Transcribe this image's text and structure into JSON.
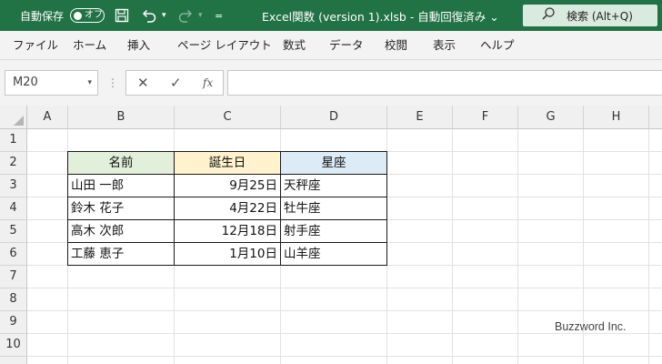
{
  "titlebar": {
    "autosave_label": "自動保存",
    "autosave_state": "オフ",
    "document_title": "Excel関数 (version 1).xlsb  -  自動回復済み  ⌄",
    "search_text": "検索 (Alt+Q)",
    "qat_more": "="
  },
  "menu": {
    "items": [
      "ファイル",
      "ホーム",
      "挿入",
      "ページ レイアウト",
      "数式",
      "データ",
      "校閲",
      "表示",
      "ヘルプ"
    ]
  },
  "formula_bar": {
    "name_box": "M20",
    "cancel_symbol": "✕",
    "enter_symbol": "✓",
    "fx_symbol": "fx",
    "content": ""
  },
  "sheet": {
    "columns": [
      "A",
      "B",
      "C",
      "D",
      "E",
      "F",
      "G",
      "H"
    ],
    "rows": [
      "1",
      "2",
      "3",
      "4",
      "5",
      "6",
      "7",
      "8",
      "9",
      "10"
    ],
    "table": {
      "headers": [
        "名前",
        "誕生日",
        "星座"
      ],
      "header_colors": [
        "#e2efda",
        "#fff2cc",
        "#ddebf7"
      ],
      "data": [
        [
          "山田 一郎",
          "9月25日",
          "天秤座"
        ],
        [
          "鈴木 花子",
          "4月22日",
          "牡牛座"
        ],
        [
          "高木 次郎",
          "12月18日",
          "射手座"
        ],
        [
          "工藤 恵子",
          "1月10日",
          "山羊座"
        ]
      ]
    }
  },
  "watermark": "Buzzword Inc.",
  "colors": {
    "title_bar": "#217346",
    "search_box": "#d9eadf",
    "menu_bg": "#f3f3f3"
  }
}
